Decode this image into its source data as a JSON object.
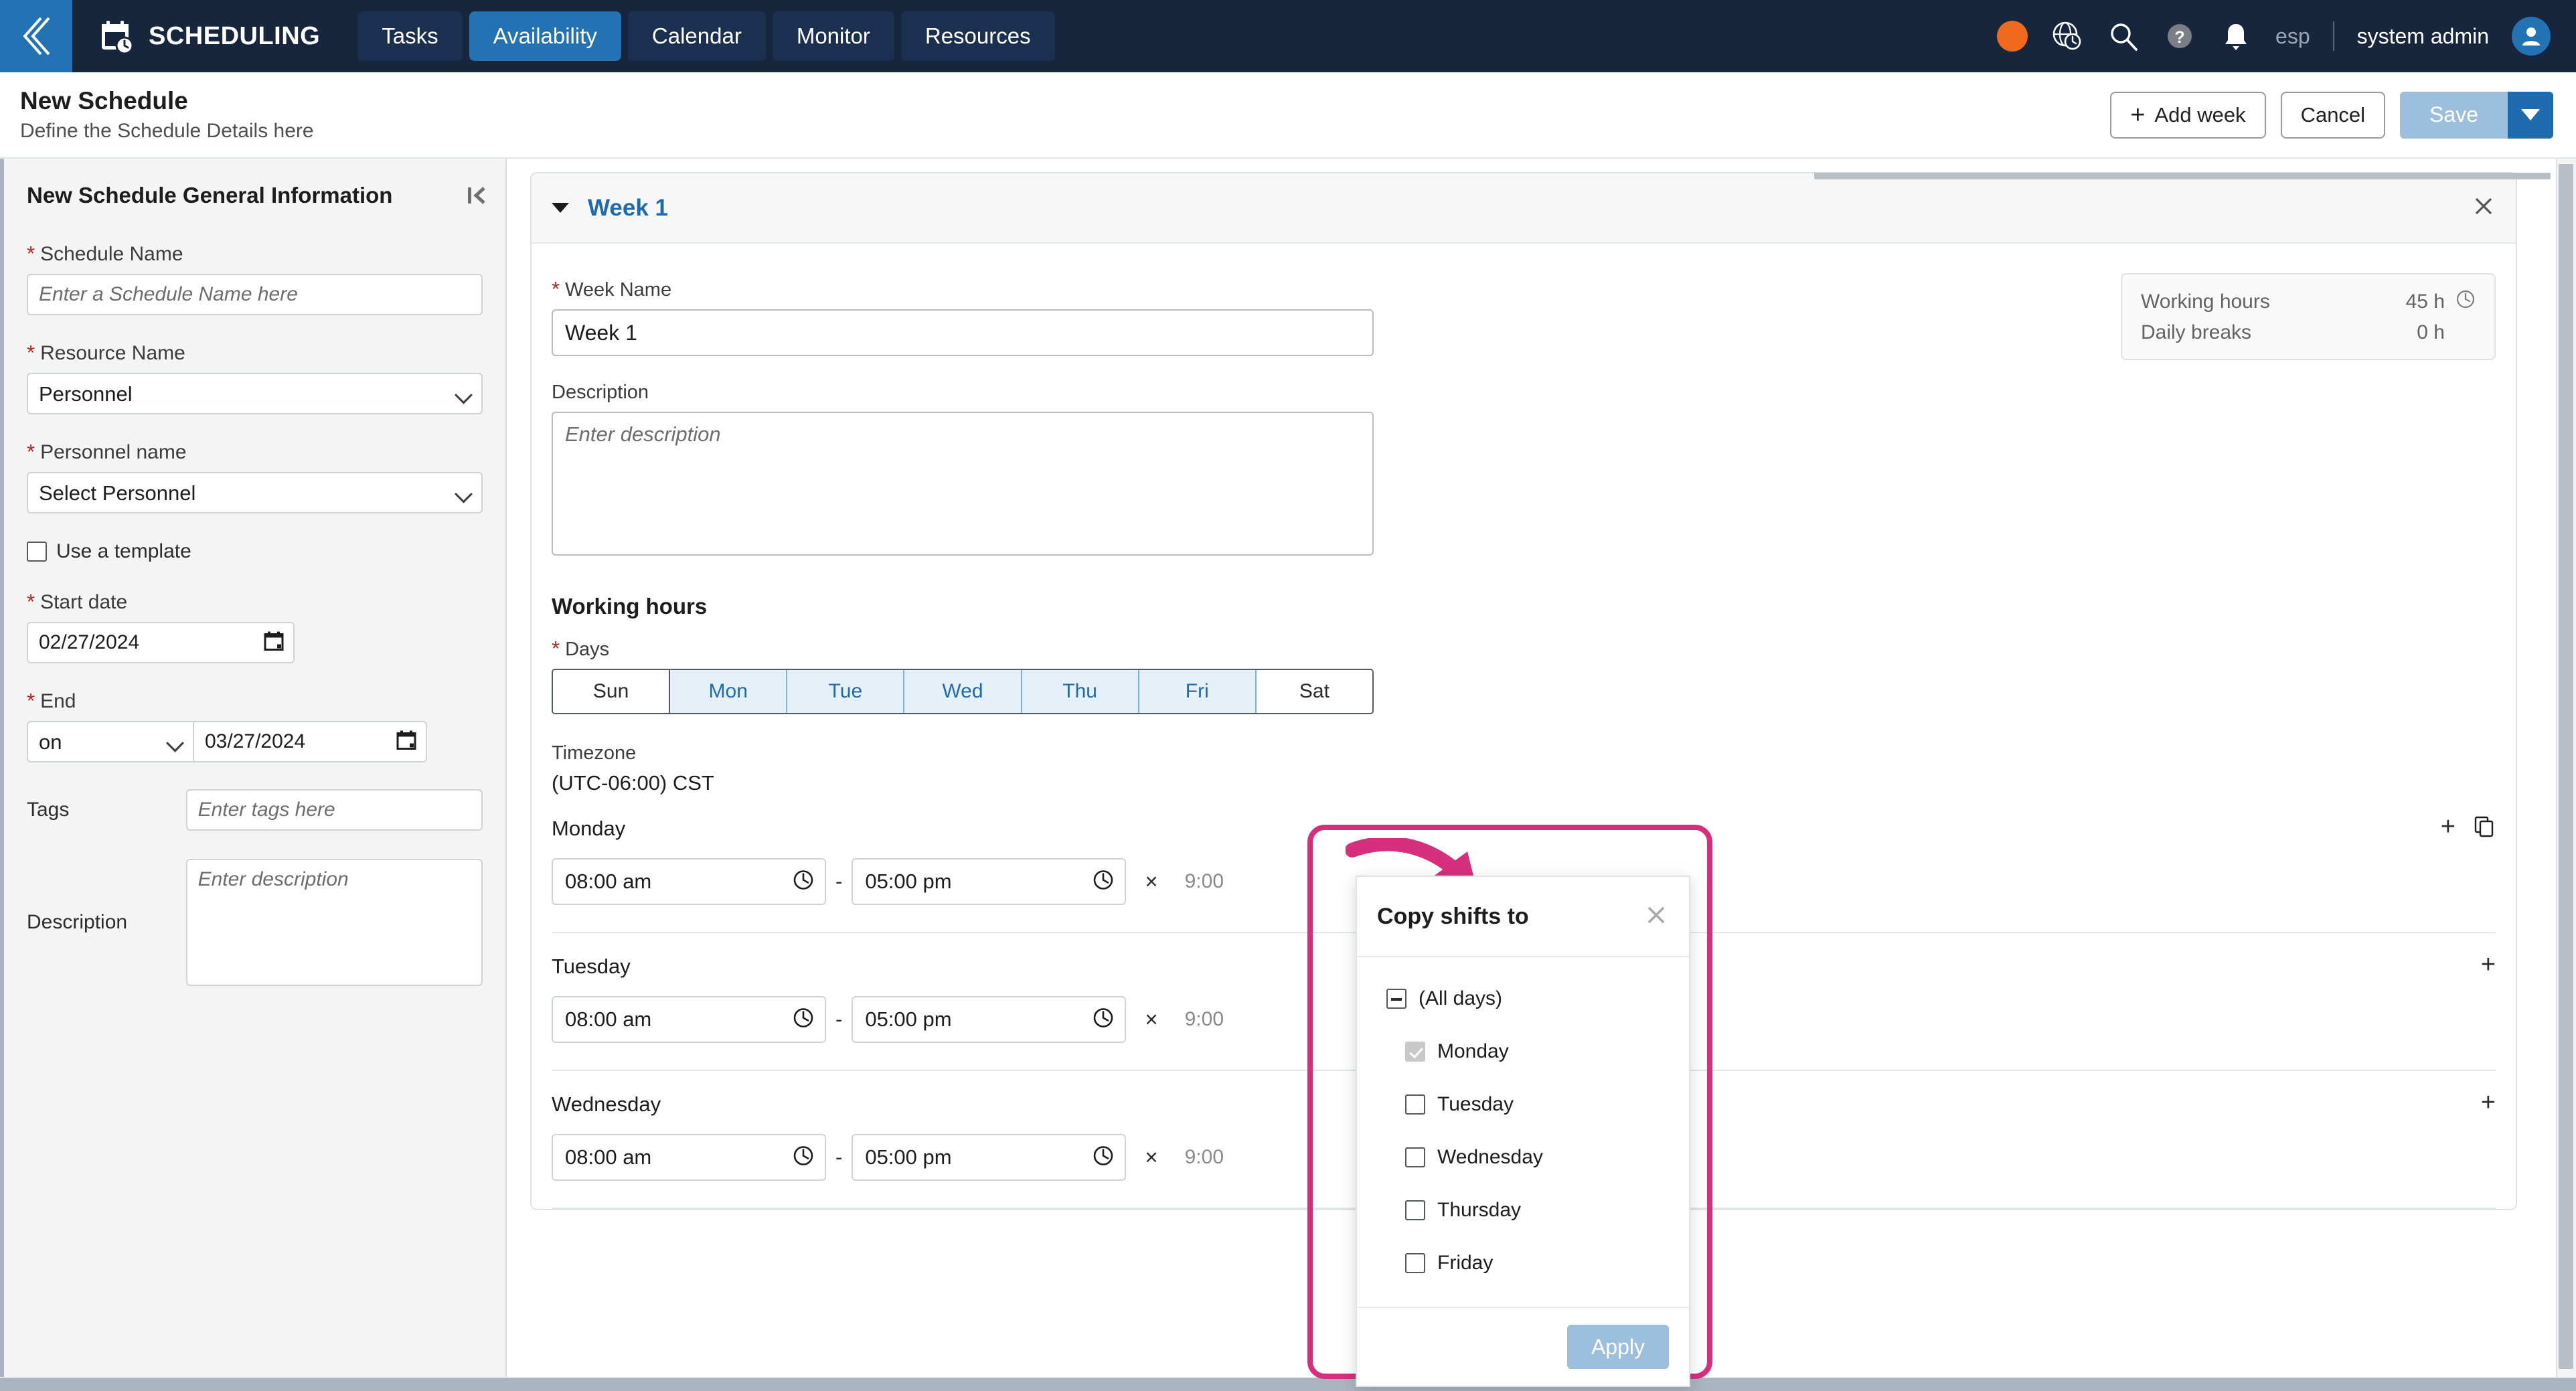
{
  "topnav": {
    "back_icon": "back-chevron-icon",
    "brand_icon": "calendar-clock-icon",
    "brand_title": "SCHEDULING",
    "tabs": [
      {
        "label": "Tasks",
        "active": false
      },
      {
        "label": "Availability",
        "active": true
      },
      {
        "label": "Calendar",
        "active": false
      },
      {
        "label": "Monitor",
        "active": false
      },
      {
        "label": "Resources",
        "active": false
      }
    ],
    "status_dot_color": "#ef6a1e",
    "icons": [
      "globe-clock-icon",
      "search-icon",
      "help-icon",
      "notification-bell-icon"
    ],
    "language": "esp",
    "username": "system admin",
    "avatar_icon": "user-avatar-icon",
    "accent": "#2272b4",
    "background": "#17263d"
  },
  "pagehead": {
    "title": "New Schedule",
    "subtitle": "Define the Schedule Details here",
    "add_week_label": "Add week",
    "add_week_plus": "+",
    "cancel_label": "Cancel",
    "save_label": "Save",
    "save_caret_icon": "chevron-down-icon"
  },
  "sidebar": {
    "title": "New Schedule General Information",
    "collapse_icon": "collapse-panel-icon",
    "schedule_name": {
      "label": "Schedule Name",
      "required": "*",
      "value": "",
      "placeholder": "Enter a Schedule Name here"
    },
    "resource_name": {
      "label": "Resource Name",
      "required": "*",
      "value": "Personnel",
      "options": [
        "Personnel"
      ]
    },
    "personnel_name": {
      "label": "Personnel name",
      "required": "*",
      "value": "Select Personnel",
      "options": [
        "Select Personnel"
      ]
    },
    "use_template": {
      "label": "Use a template",
      "checked": false
    },
    "start_date": {
      "label": "Start date",
      "required": "*",
      "value": "02/27/2024"
    },
    "end": {
      "label": "End",
      "required": "*",
      "mode_value": "on",
      "mode_options": [
        "on"
      ],
      "date_value": "03/27/2024"
    },
    "tags": {
      "label": "Tags",
      "value": "",
      "placeholder": "Enter tags here"
    },
    "description": {
      "label": "Description",
      "value": "",
      "placeholder": "Enter description"
    }
  },
  "week": {
    "header_title": "Week 1",
    "collapse_icon": "triangle-down-icon",
    "close_icon": "close-icon",
    "week_name": {
      "label": "Week Name",
      "required": "*",
      "value": "Week 1"
    },
    "description": {
      "label": "Description",
      "value": "",
      "placeholder": "Enter description"
    },
    "working_hours_title": "Working hours",
    "days_label": "Days",
    "days_required": "*",
    "days": [
      {
        "label": "Sun",
        "selected": false
      },
      {
        "label": "Mon",
        "selected": true
      },
      {
        "label": "Tue",
        "selected": true
      },
      {
        "label": "Wed",
        "selected": true
      },
      {
        "label": "Thu",
        "selected": true
      },
      {
        "label": "Fri",
        "selected": true
      },
      {
        "label": "Sat",
        "selected": false
      }
    ],
    "timezone_label": "Timezone",
    "timezone_value": "(UTC-06:00) CST",
    "summary": {
      "working_hours_label": "Working hours",
      "working_hours_value": "45 h",
      "clock_icon": "clock-icon",
      "daily_breaks_label": "Daily breaks",
      "daily_breaks_value": "0 h"
    },
    "day_rows": [
      {
        "name": "Monday",
        "start": "08:00 am",
        "end": "05:00 pm",
        "duration": "9:00",
        "delete_label": "×",
        "add_label": "+",
        "copy_icon": "copy-icon"
      },
      {
        "name": "Tuesday",
        "start": "08:00 am",
        "end": "05:00 pm",
        "duration": "9:00",
        "delete_label": "×",
        "add_label": "+",
        "copy_icon": "copy-icon"
      },
      {
        "name": "Wednesday",
        "start": "08:00 am",
        "end": "05:00 pm",
        "duration": "9:00",
        "delete_label": "×",
        "add_label": "+",
        "copy_icon": "copy-icon"
      }
    ],
    "time_separator": "-"
  },
  "popup": {
    "title": "Copy shifts to",
    "close_icon": "close-icon",
    "all_days_label": "(All days)",
    "all_days_state": "indeterminate",
    "items": [
      {
        "label": "Monday",
        "checked": true,
        "disabled": true
      },
      {
        "label": "Tuesday",
        "checked": false,
        "disabled": false
      },
      {
        "label": "Wednesday",
        "checked": false,
        "disabled": false
      },
      {
        "label": "Thursday",
        "checked": false,
        "disabled": false
      },
      {
        "label": "Friday",
        "checked": false,
        "disabled": false
      }
    ],
    "apply_label": "Apply"
  },
  "annotation": {
    "highlight_color": "#d62f7e",
    "arrow_icon": "curved-arrow-icon"
  }
}
